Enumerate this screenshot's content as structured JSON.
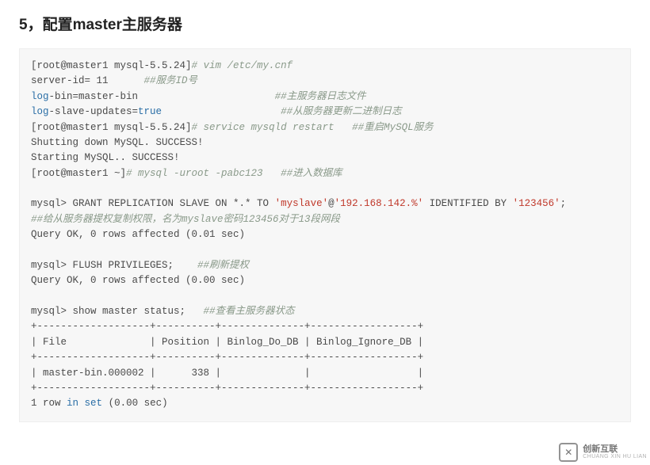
{
  "heading": "5，配置master主服务器",
  "watermark": {
    "cn": "创新互联",
    "py": "CHUANG XIN HU LIAN"
  },
  "code": [
    [
      {
        "cls": "c-plain",
        "t": "[root@master1 mysql-5.5.24]"
      },
      {
        "cls": "c-comment",
        "t": "# vim /etc/my.cnf"
      }
    ],
    [
      {
        "cls": "c-plain",
        "t": "server-id= 11      "
      },
      {
        "cls": "c-comment",
        "t": "##服务ID号"
      }
    ],
    [
      {
        "cls": "c-key",
        "t": "log"
      },
      {
        "cls": "c-plain",
        "t": "-bin=master-bin                       "
      },
      {
        "cls": "c-comment",
        "t": "##主服务器日志文件"
      }
    ],
    [
      {
        "cls": "c-key",
        "t": "log"
      },
      {
        "cls": "c-plain",
        "t": "-slave-updates="
      },
      {
        "cls": "c-true",
        "t": "true"
      },
      {
        "cls": "c-plain",
        "t": "                    "
      },
      {
        "cls": "c-comment",
        "t": "##从服务器更新二进制日志"
      }
    ],
    [
      {
        "cls": "c-plain",
        "t": "[root@master1 mysql-5.5.24]"
      },
      {
        "cls": "c-comment",
        "t": "# service mysqld restart   ##重启MySQL服务"
      }
    ],
    [
      {
        "cls": "c-plain",
        "t": "Shutting down MySQL. SUCCESS!"
      }
    ],
    [
      {
        "cls": "c-plain",
        "t": "Starting MySQL.. SUCCESS!"
      }
    ],
    [
      {
        "cls": "c-plain",
        "t": "[root@master1 ~]"
      },
      {
        "cls": "c-comment",
        "t": "# mysql -uroot -pabc123   ##进入数据库"
      }
    ],
    [
      {
        "cls": "",
        "t": ""
      }
    ],
    [
      {
        "cls": "c-plain",
        "t": "mysql> GRANT REPLICATION SLAVE ON *.* TO "
      },
      {
        "cls": "c-str",
        "t": "'myslave'"
      },
      {
        "cls": "c-plain",
        "t": "@"
      },
      {
        "cls": "c-ip",
        "t": "'192.168.142.%'"
      },
      {
        "cls": "c-plain",
        "t": " IDENTIFIED BY "
      },
      {
        "cls": "c-str",
        "t": "'123456'"
      },
      {
        "cls": "c-plain",
        "t": ";"
      }
    ],
    [
      {
        "cls": "c-comment",
        "t": "##给从服务器提权复制权限，名为myslave密码123456对于13段网段"
      }
    ],
    [
      {
        "cls": "c-plain",
        "t": "Query OK, 0 rows affected (0.01 sec)"
      }
    ],
    [
      {
        "cls": "",
        "t": ""
      }
    ],
    [
      {
        "cls": "c-plain",
        "t": "mysql> FLUSH PRIVILEGES;    "
      },
      {
        "cls": "c-comment",
        "t": "##刷新提权"
      }
    ],
    [
      {
        "cls": "c-plain",
        "t": "Query OK, 0 rows affected (0.00 sec)"
      }
    ],
    [
      {
        "cls": "",
        "t": ""
      }
    ],
    [
      {
        "cls": "c-plain",
        "t": "mysql> show master status;   "
      },
      {
        "cls": "c-comment",
        "t": "##查看主服务器状态"
      }
    ],
    [
      {
        "cls": "c-plain",
        "t": "+-------------------+----------+--------------+------------------+"
      }
    ],
    [
      {
        "cls": "c-plain",
        "t": "| File              | Position | Binlog_Do_DB | Binlog_Ignore_DB |"
      }
    ],
    [
      {
        "cls": "c-plain",
        "t": "+-------------------+----------+--------------+------------------+"
      }
    ],
    [
      {
        "cls": "c-plain",
        "t": "| master-bin.000002 |      338 |              |                  |"
      }
    ],
    [
      {
        "cls": "c-plain",
        "t": "+-------------------+----------+--------------+------------------+"
      }
    ],
    [
      {
        "cls": "c-plain",
        "t": "1 row "
      },
      {
        "cls": "c-hl",
        "t": "in"
      },
      {
        "cls": "c-plain",
        "t": " "
      },
      {
        "cls": "c-hl",
        "t": "set"
      },
      {
        "cls": "c-plain",
        "t": " (0.00 sec)"
      }
    ]
  ]
}
